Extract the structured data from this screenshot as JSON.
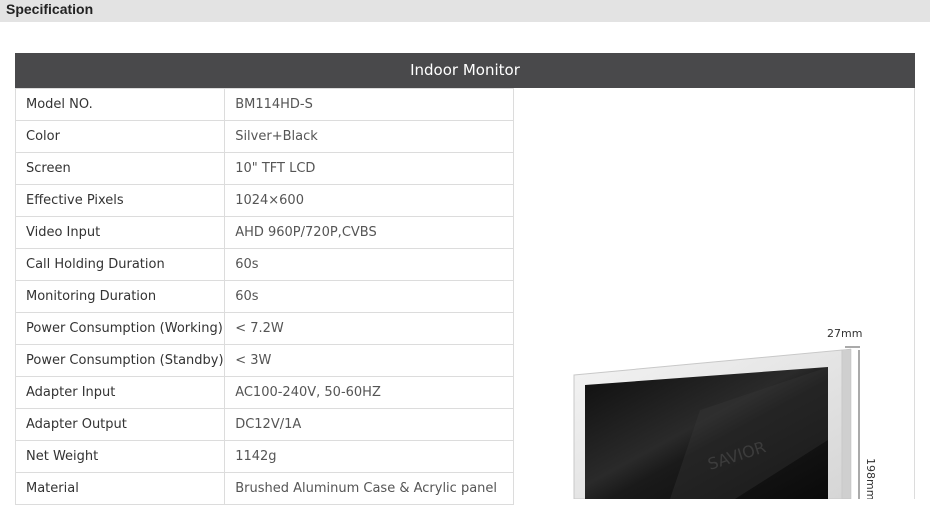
{
  "section": {
    "title": "Specification"
  },
  "table": {
    "title": "Indoor Monitor",
    "rows": [
      {
        "label": "Model NO.",
        "value": "BM114HD-S"
      },
      {
        "label": "Color",
        "value": "Silver+Black"
      },
      {
        "label": "Screen",
        "value": "10\" TFT LCD"
      },
      {
        "label": "Effective Pixels",
        "value": "1024×600"
      },
      {
        "label": "Video Input",
        "value": "AHD 960P/720P,CVBS"
      },
      {
        "label": "Call Holding Duration",
        "value": "60s"
      },
      {
        "label": "Monitoring Duration",
        "value": "60s"
      },
      {
        "label": "Power Consumption (Working)",
        "value": "< 7.2W"
      },
      {
        "label": "Power Consumption (Standby)",
        "value": "< 3W"
      },
      {
        "label": "Adapter Input",
        "value": "AC100-240V, 50-60HZ"
      },
      {
        "label": "Adapter Output",
        "value": "DC12V/1A"
      },
      {
        "label": "Net Weight",
        "value": "1142g"
      },
      {
        "label": "Material",
        "value": "Brushed Aluminum Case & Acrylic panel"
      }
    ]
  },
  "product_image": {
    "depth_label": "27mm",
    "height_label": "198mm",
    "watermark": "SAVIOR"
  }
}
